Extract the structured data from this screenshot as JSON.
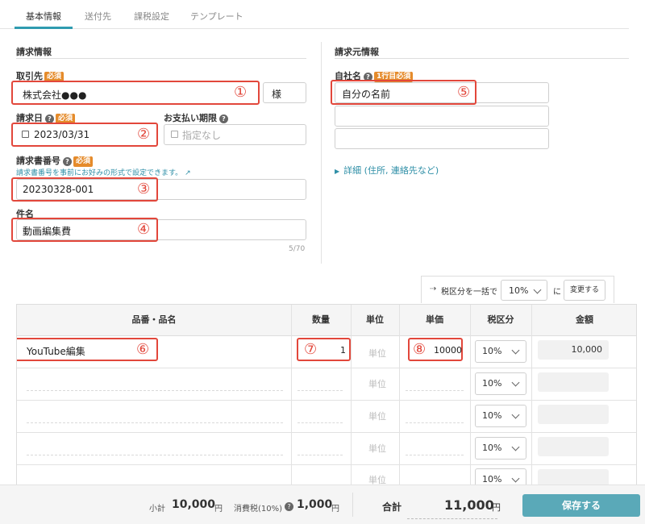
{
  "tabs": [
    {
      "label": "基本情報",
      "active": true
    },
    {
      "label": "送付先"
    },
    {
      "label": "課税設定"
    },
    {
      "label": "テンプレート"
    }
  ],
  "billing_to": {
    "section_title": "請求情報",
    "client": {
      "label": "取引先",
      "required": "必須",
      "value": "株式会社●●●",
      "suffix": "様",
      "marker": "①"
    },
    "invoice_date": {
      "label": "請求日",
      "required": "必須",
      "value": "2023/03/31",
      "marker": "②"
    },
    "due_date": {
      "label": "お支払い期限",
      "placeholder": "指定なし"
    },
    "invoice_number": {
      "label": "請求書番号",
      "required": "必須",
      "note": "請求書番号を事前にお好みの形式で設定できます。",
      "value": "20230328-001",
      "marker": "③"
    },
    "subject": {
      "label": "件名",
      "value": "動画編集費",
      "marker": "④",
      "counter": "5/70"
    }
  },
  "billing_from": {
    "section_title": "請求元情報",
    "company": {
      "label": "自社名",
      "required": "1行目必須",
      "value": "自分の名前",
      "marker": "⑤"
    },
    "details_link": "詳細 (住所, 連絡先など)"
  },
  "bulk_tax": {
    "label": "税区分を一括で",
    "value": "10%",
    "suffix": "に",
    "button": "変更する"
  },
  "table": {
    "headers": {
      "item": "品番・品名",
      "qty": "数量",
      "unit": "単位",
      "price": "単価",
      "tax": "税区分",
      "amount": "金額"
    },
    "unit_placeholder": "単位",
    "rows": [
      {
        "item": "YouTube編集",
        "item_marker": "⑥",
        "qty": "1",
        "qty_marker": "⑦",
        "price": "10000",
        "price_marker": "⑧",
        "tax": "10%",
        "amount": "10,000"
      },
      {
        "item": "",
        "qty": "",
        "price": "",
        "tax": "10%",
        "amount": ""
      },
      {
        "item": "",
        "qty": "",
        "price": "",
        "tax": "10%",
        "amount": ""
      },
      {
        "item": "",
        "qty": "",
        "price": "",
        "tax": "10%",
        "amount": ""
      },
      {
        "item": "",
        "qty": "",
        "price": "",
        "tax": "10%",
        "amount": ""
      }
    ]
  },
  "footer": {
    "subtotal_label": "小計",
    "subtotal": "10,000",
    "yen": "円",
    "tax_label": "消費税(10%)",
    "tax": "1,000",
    "total_label": "合計",
    "total": "11,000",
    "save_button": "保存する"
  }
}
